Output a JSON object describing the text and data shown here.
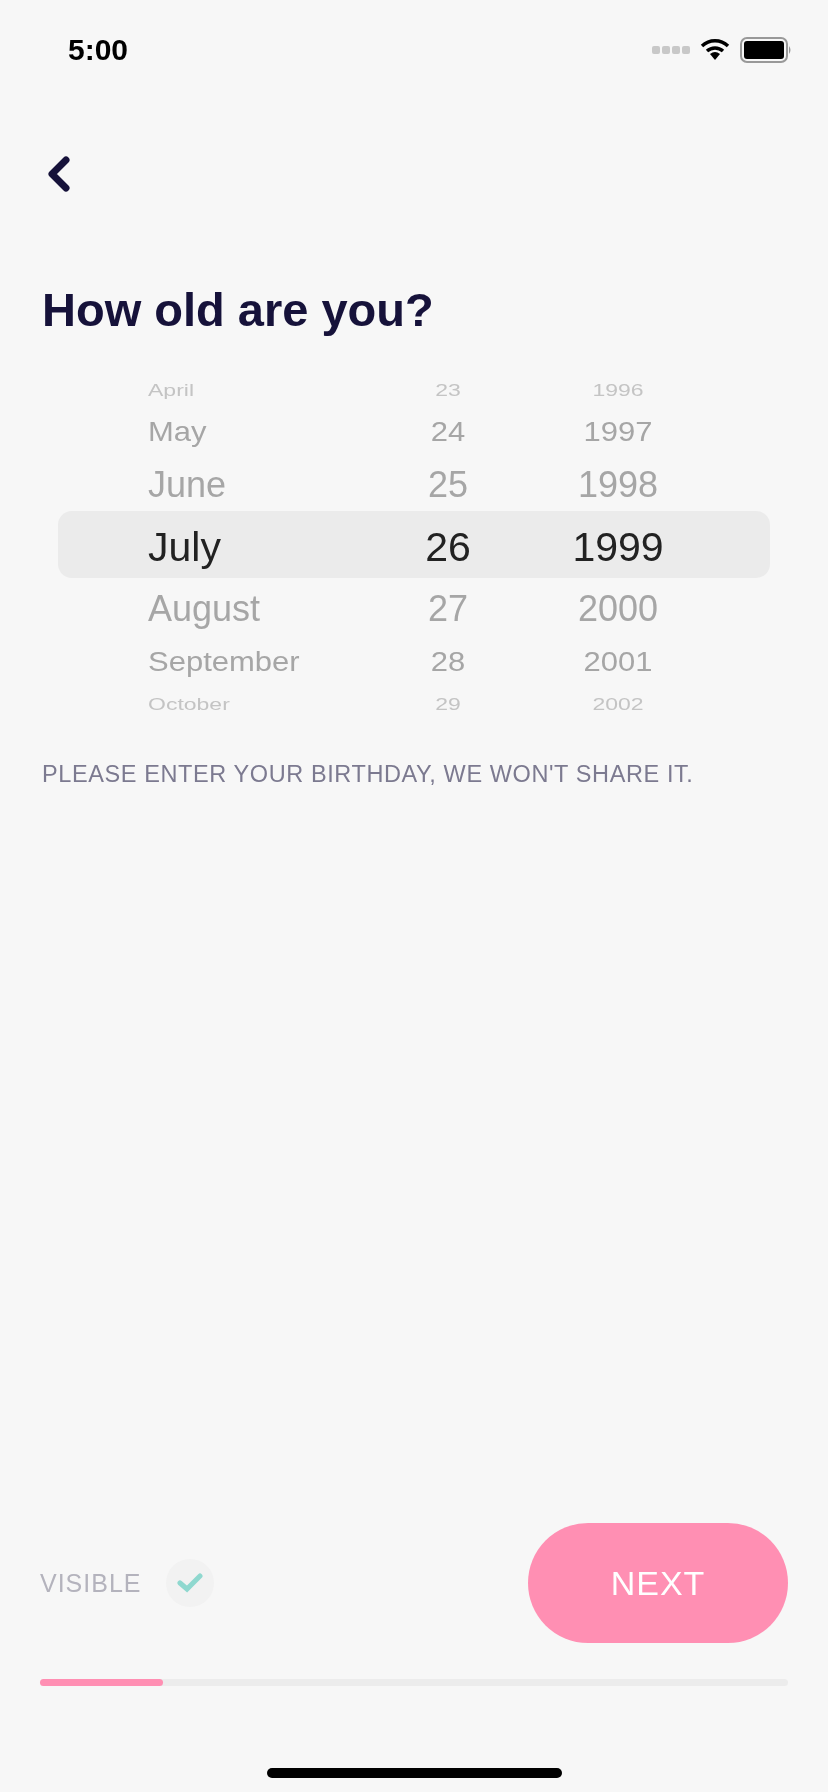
{
  "status_bar": {
    "time": "5:00"
  },
  "title": "How old are you?",
  "picker": {
    "columns": [
      {
        "kind": "month",
        "items": [
          {
            "label": "April",
            "selected": false
          },
          {
            "label": "May",
            "selected": false
          },
          {
            "label": "June",
            "selected": false
          },
          {
            "label": "July",
            "selected": true
          },
          {
            "label": "August",
            "selected": false
          },
          {
            "label": "September",
            "selected": false
          },
          {
            "label": "October",
            "selected": false
          }
        ]
      },
      {
        "kind": "day",
        "items": [
          {
            "label": "23",
            "selected": false
          },
          {
            "label": "24",
            "selected": false
          },
          {
            "label": "25",
            "selected": false
          },
          {
            "label": "26",
            "selected": true
          },
          {
            "label": "27",
            "selected": false
          },
          {
            "label": "28",
            "selected": false
          },
          {
            "label": "29",
            "selected": false
          }
        ]
      },
      {
        "kind": "year",
        "items": [
          {
            "label": "1996",
            "selected": false
          },
          {
            "label": "1997",
            "selected": false
          },
          {
            "label": "1998",
            "selected": false
          },
          {
            "label": "1999",
            "selected": true
          },
          {
            "label": "2000",
            "selected": false
          },
          {
            "label": "2001",
            "selected": false
          },
          {
            "label": "2002",
            "selected": false
          }
        ]
      }
    ]
  },
  "hint": "PLEASE ENTER YOUR BIRTHDAY, WE WON'T SHARE IT.",
  "visibility": {
    "label": "VISIBLE",
    "checked": true
  },
  "next_button": {
    "label": "NEXT"
  },
  "progress": {
    "level": 0.165
  }
}
